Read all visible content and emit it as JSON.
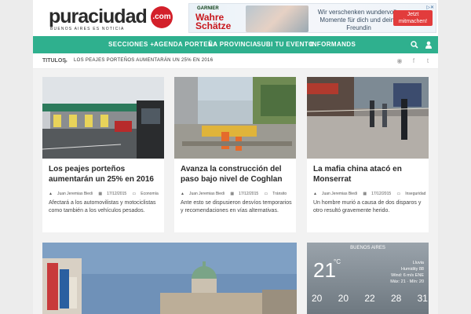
{
  "logo": {
    "word": "puraciudad",
    "com": ".com",
    "tagline": "BUENOS AIRES ES NOTICIA"
  },
  "ad": {
    "brand": "GARNIER",
    "title": "Wahre Schätze",
    "text": "Wir verschenken wundervolle Momente für dich und deine Freundin",
    "button": "Jetzt mitmachen!",
    "close": "▷✕"
  },
  "nav": {
    "items": [
      "SECCIONES +",
      "AGENDA PORTEÑA",
      "LA PROVINCIA",
      "SUBI TU EVENTO",
      "INFORMANDS"
    ]
  },
  "ticker": {
    "label": "TITULOS",
    "text": "LOS PEAJES PORTEÑOS AUMENTARÁN UN 25% EN 2016",
    "icons": [
      "rss-icon",
      "facebook-icon",
      "twitter-icon"
    ]
  },
  "cards": [
    {
      "title": "Los peajes porteños aumentarán un 25% en 2016",
      "author": "Juan Jeremias Biedi",
      "date": "17/12/2015",
      "category": "Economía",
      "excerpt": "Afectará a los automovilistas y motociclistas como también a los vehículos pesados."
    },
    {
      "title": "Avanza la construcción del paso bajo nivel de Coghlan",
      "author": "Juan Jeremias Biedi",
      "date": "17/12/2015",
      "category": "Tránsito",
      "excerpt": "Ante esto se dispusieron desvíos temporarios y recomendaciones en vías alternativas."
    },
    {
      "title": "La mafia china atacó en Monserrat",
      "author": "Juan Jeremias Biedi",
      "date": "17/12/2015",
      "category": "Inseguridad",
      "excerpt": "Un hombre murió a causa de dos disparos y otro resultó gravemente herido."
    }
  ],
  "weather": {
    "city": "BUENOS AIRES",
    "temp": "21",
    "unit": "°C",
    "details": [
      "Lluvia",
      "Humidity 88",
      "Wind: 6 m/s ENE",
      "Máx: 21 · Mín: 20"
    ],
    "days": [
      "20",
      "20",
      "22",
      "28",
      "31"
    ]
  }
}
